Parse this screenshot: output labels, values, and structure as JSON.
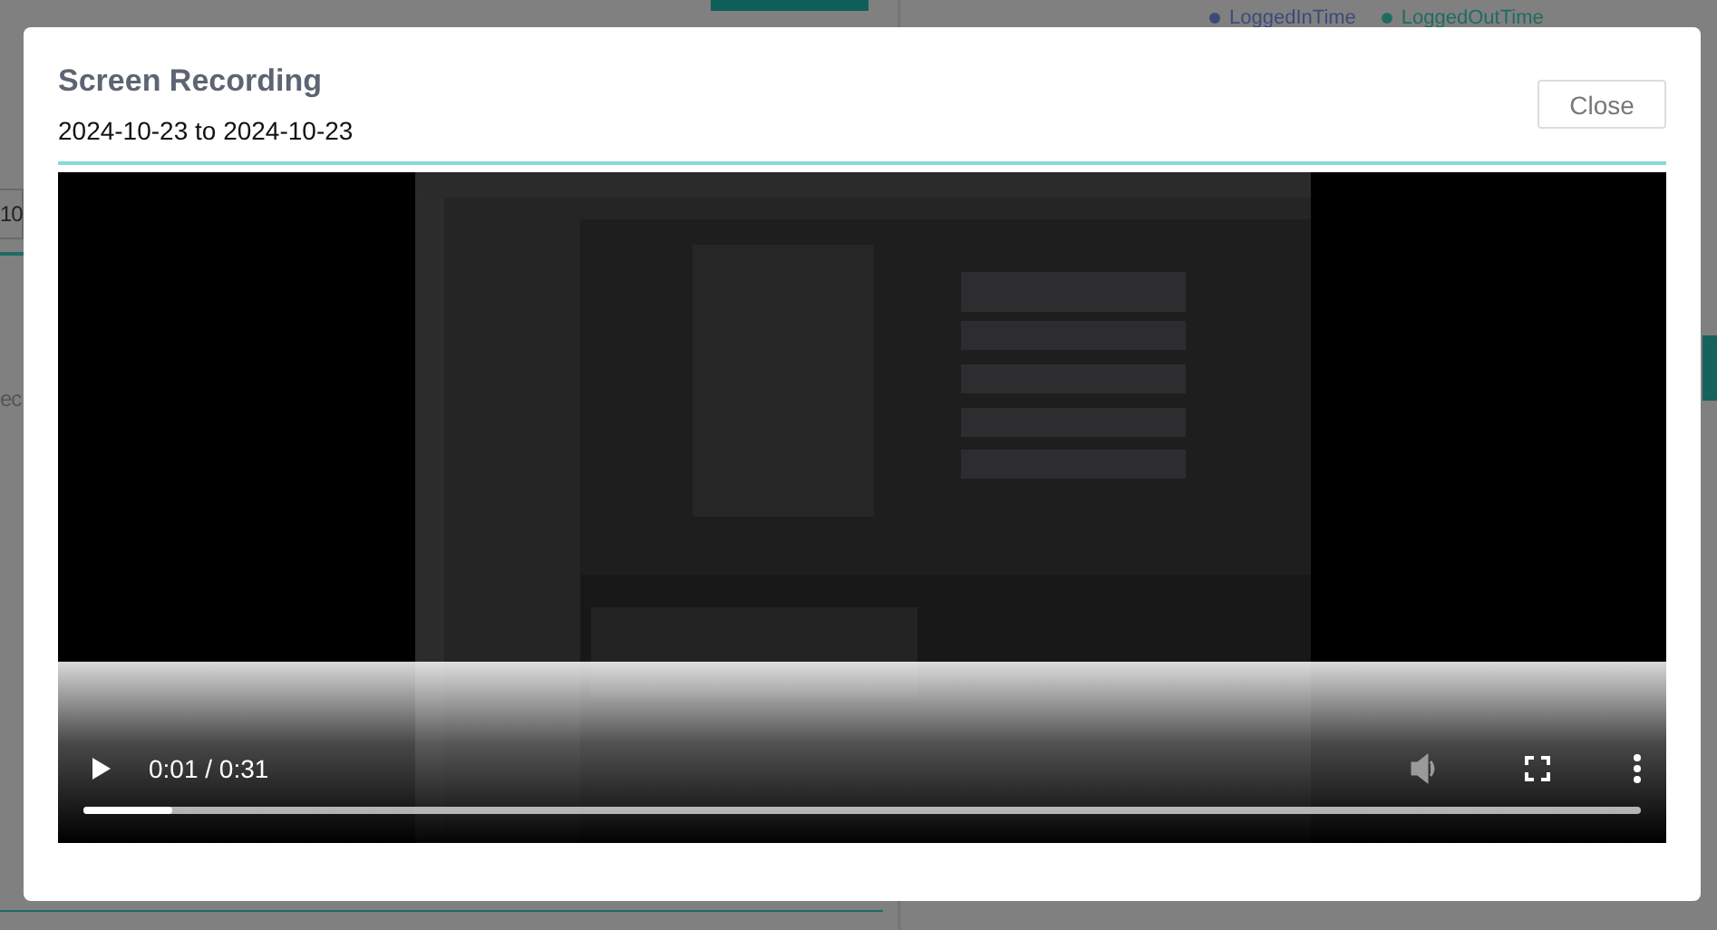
{
  "background": {
    "legend": [
      {
        "label": "LoggedInTime",
        "color": "#3b4a7a"
      },
      {
        "label": "LoggedOutTime",
        "color": "#1f6b62"
      }
    ],
    "field_value": "10",
    "text_fragment": "ec"
  },
  "modal": {
    "title": "Screen Recording",
    "date_range": "2024-10-23 to 2024-10-23",
    "close_button": "Close",
    "video": {
      "kind": "picture",
      "time": "0:01 / 0:31",
      "level": 0.057
    }
  }
}
